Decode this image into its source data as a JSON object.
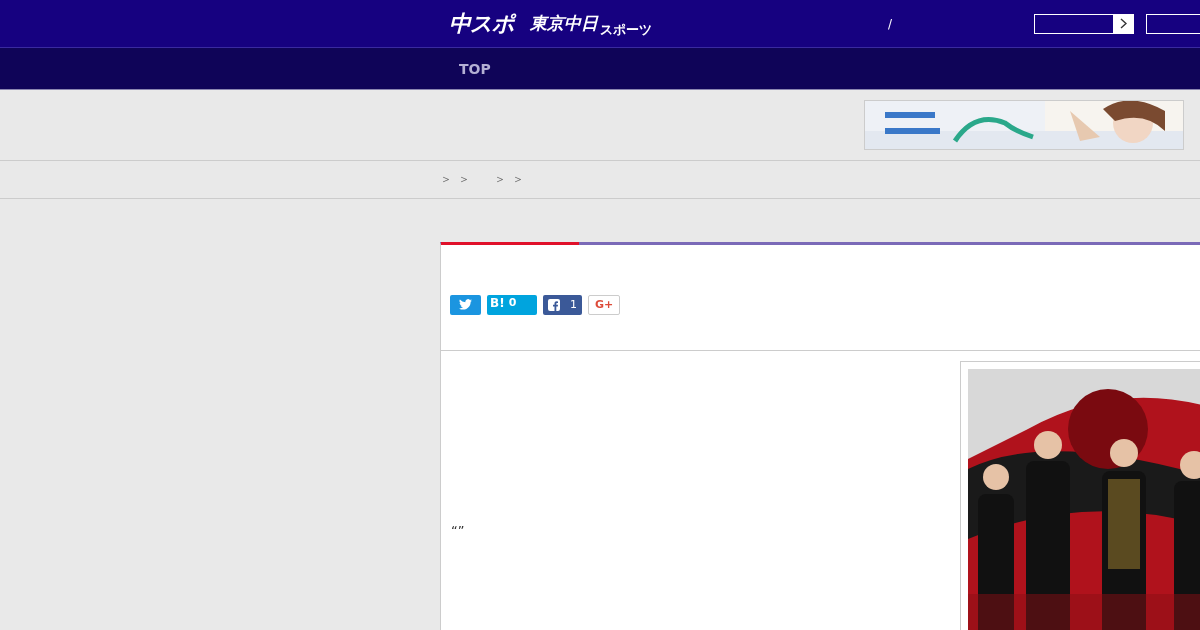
{
  "header": {
    "logo": "中スポ",
    "sublogo": "東京中日",
    "sublogo_small": "スポーツ",
    "separator": "/"
  },
  "nav": [
    {
      "label": "TOP"
    }
  ],
  "breadcrumb": [
    "＞",
    "＞",
    "＞",
    "＞"
  ],
  "article": {
    "share": [
      {
        "kind": "twitter"
      },
      {
        "kind": "hatena",
        "label": "B!",
        "count": "0"
      },
      {
        "kind": "facebook",
        "count": "1"
      },
      {
        "kind": "google",
        "label": "G+"
      }
    ],
    "body": "“”"
  }
}
